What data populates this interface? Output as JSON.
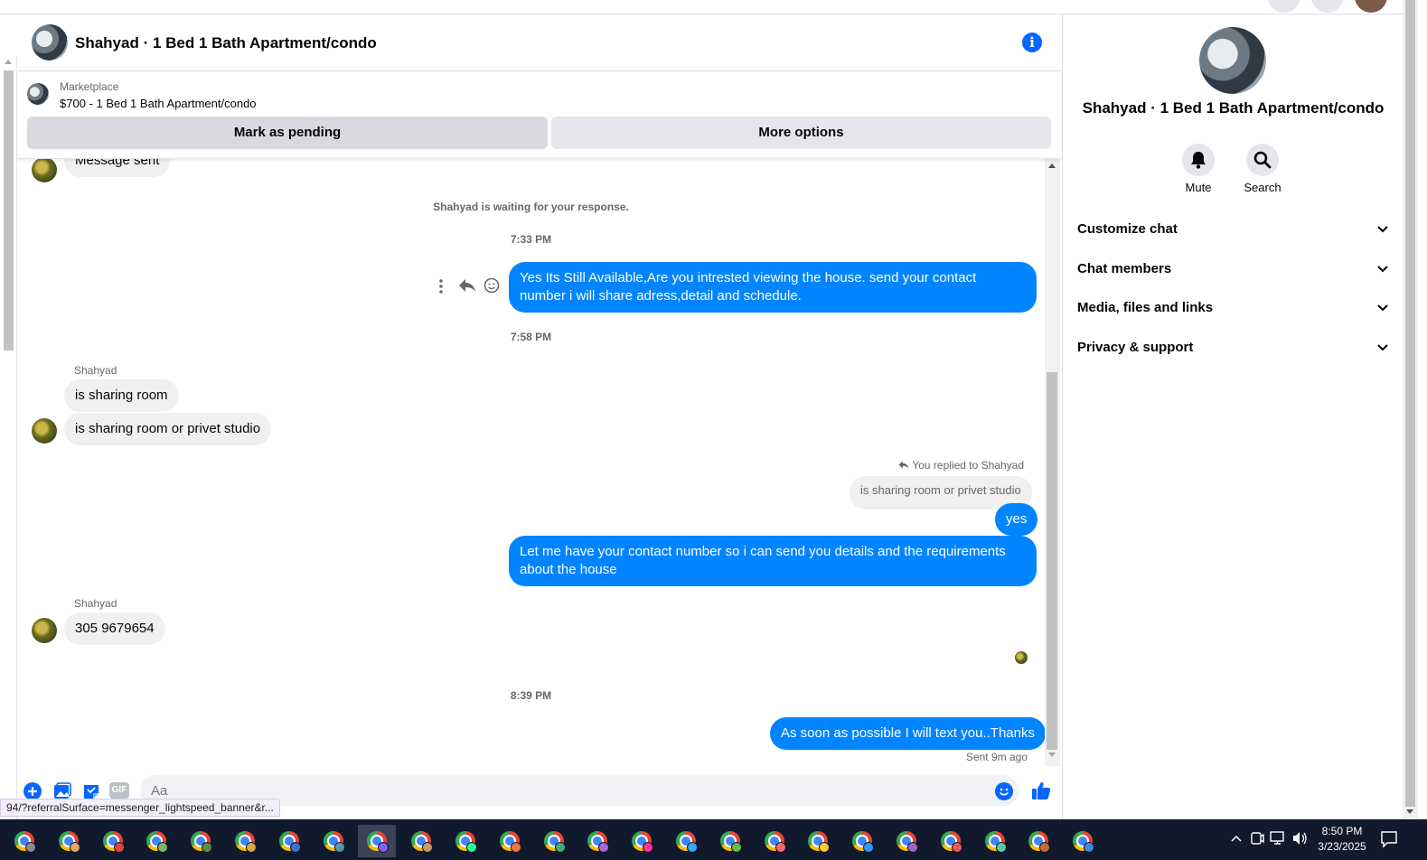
{
  "chat": {
    "title": "Shahyad · 1 Bed 1 Bath Apartment/condo"
  },
  "marketplace": {
    "label": "Marketplace",
    "item": "$700 - 1 Bed 1 Bath Apartment/condo",
    "pending_button": "Mark as pending",
    "more_button": "More options"
  },
  "messages": {
    "partial_sent": "Message sent",
    "waiting_notice": "Shahyad is waiting for your response.",
    "time1": "7:33 PM",
    "out1": "Yes Its Still Available,Are you intrested viewing the house. send your contact number i will share adress,detail and schedule.",
    "time2": "7:58 PM",
    "sender1": "Shahyad",
    "in1": "is sharing room",
    "in2": "is  sharing room or privet studio",
    "replied_label": "You replied to Shahyad",
    "quoted": "is  sharing room or privet studio",
    "out2": "yes",
    "out3": "Let me have your contact number so i can send you details and the requirements about the house",
    "sender2": "Shahyad",
    "in3": "305 9679654",
    "time3": "8:39 PM",
    "out4": "As soon as possible I will text you..Thanks",
    "sent_status": "Sent 9m ago"
  },
  "composer": {
    "placeholder": "Aa",
    "gif_label": "GIF"
  },
  "status_url": "94/?referralSurface=messenger_lightspeed_banner&r...",
  "right_panel": {
    "title": "Shahyad · 1 Bed 1 Bath Apartment/condo",
    "mute_label": "Mute",
    "search_label": "Search",
    "sections": [
      "Customize chat",
      "Chat members",
      "Media, files and links",
      "Privacy & support"
    ]
  },
  "taskbar": {
    "time": "8:50 PM",
    "date": "3/23/2025",
    "profile_badge_colors": [
      "#8a8a8a",
      "#e0a96d",
      "#d44",
      "#7cb36a",
      "#5a8f3c",
      "#d9a441",
      "#3b6fd6",
      "#59a",
      "#8b5cf6",
      "#c49a6c",
      "#2f9",
      "#e74",
      "#4a7",
      "#a6d",
      "#f39",
      "#3af",
      "#6b4",
      "#f66",
      "#fc3",
      "#39f",
      "#96c",
      "#e55",
      "#5c9",
      "#c63",
      "#48d"
    ]
  },
  "colors": {
    "accent": "#0084ff",
    "brand": "#0866ff"
  }
}
